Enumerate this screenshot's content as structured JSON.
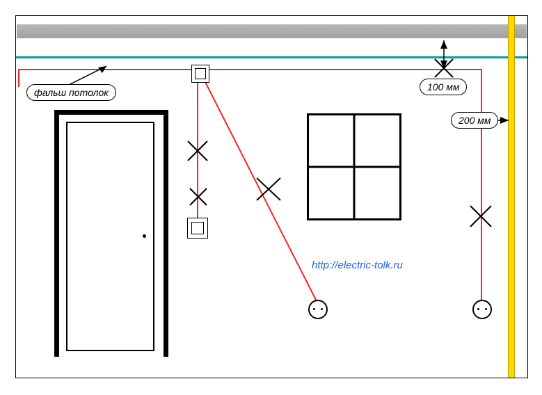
{
  "diagram": {
    "kind": "electrical-wiring-wall-elevation",
    "false_ceiling_label": "фальш потолок",
    "dimension_top": "100 мм",
    "dimension_right": "200 мм",
    "url_text": "http://electric-tolk.ru",
    "colors": {
      "wiring": "#ff2020",
      "pipe": "#ffd800",
      "false_ceiling": "#00a0a0",
      "slab": "#a8a8a8"
    },
    "elements": {
      "door": true,
      "window": true,
      "junction_box": true,
      "wall_switch": true,
      "socket_count": 2,
      "prohibition_marks": 5
    }
  }
}
